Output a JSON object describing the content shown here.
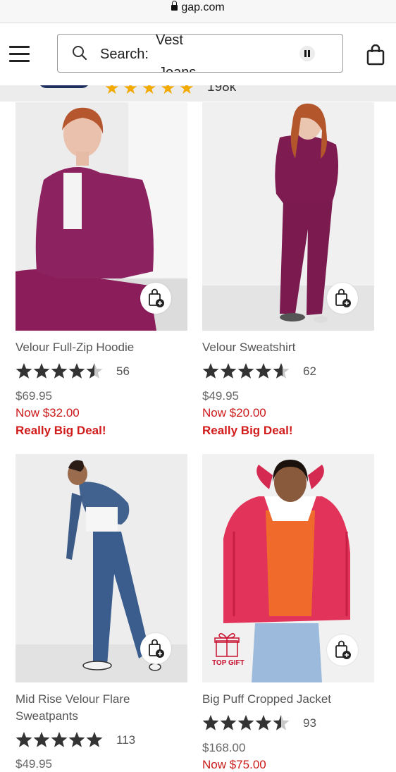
{
  "browser": {
    "url": "gap.com"
  },
  "header": {
    "search_label": "Search:",
    "search_rotating_1": "Vest",
    "search_rotating_2": "Jeans"
  },
  "promo_strip": {
    "rating_count": "198k"
  },
  "products": [
    {
      "name": "Velour Full-Zip Hoodie",
      "rating": 4.5,
      "reviews": "56",
      "price": "$69.95",
      "sale": "Now $32.00",
      "badge": "Really Big Deal!"
    },
    {
      "name": "Velour Sweatshirt",
      "rating": 4.5,
      "reviews": "62",
      "price": "$49.95",
      "sale": "Now $20.00",
      "badge": "Really Big Deal!"
    },
    {
      "name": "Mid Rise Velour Flare Sweatpants",
      "rating": 5,
      "reviews": "113",
      "price": "$49.95",
      "sale": "",
      "badge": ""
    },
    {
      "name": "Big Puff Cropped Jacket",
      "rating": 4.5,
      "reviews": "93",
      "price": "$168.00",
      "sale": "Now $75.00",
      "badge": "",
      "tag": "TOP GIFT"
    }
  ],
  "colors": {
    "sale_red": "#cc1a1a",
    "star_dark": "#333333",
    "star_gold": "#f2a900",
    "nav_blue": "#1d2f5e"
  }
}
